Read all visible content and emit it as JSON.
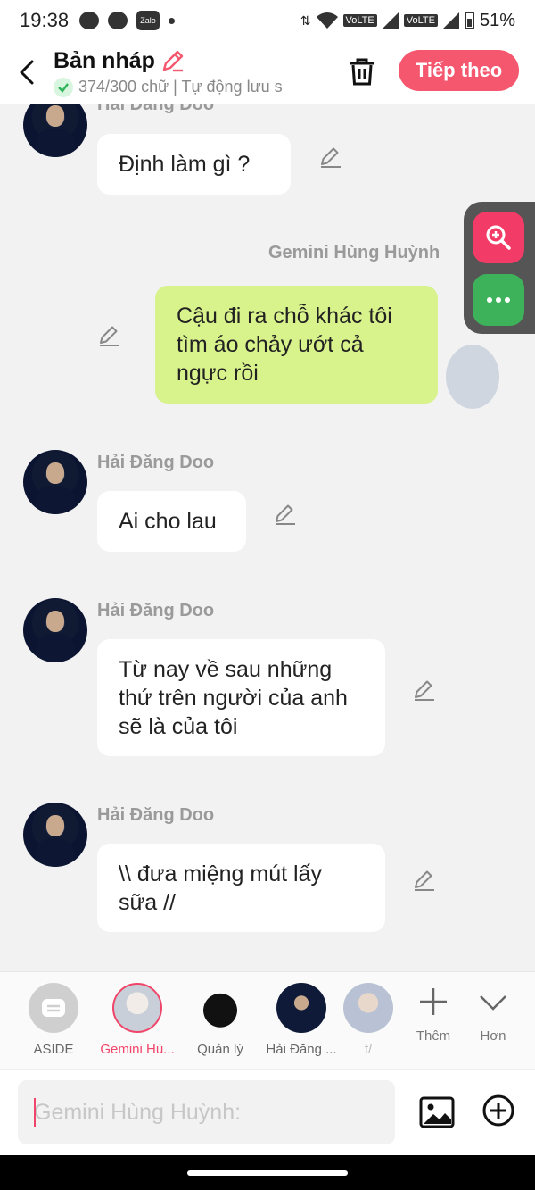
{
  "status_bar": {
    "time": "19:38",
    "zalo": "Zalo",
    "volte1": "VoLTE",
    "volte2": "VoLTE",
    "battery": "51%"
  },
  "header": {
    "title": "Bản nháp",
    "subtitle": "374/300 chữ | Tự động lưu s",
    "next_label": "Tiếp theo"
  },
  "messages": [
    {
      "sender": "Hải Đăng Doo",
      "text": "Định làm gì ?",
      "side": "left"
    },
    {
      "sender": "Gemini Hùng Huỳnh",
      "text": "Cậu đi ra chỗ khác tôi tìm áo chảy ướt cả ngực rồi",
      "side": "right"
    },
    {
      "sender": "Hải Đăng Doo",
      "text": "Ai cho lau",
      "side": "left"
    },
    {
      "sender": "Hải Đăng Doo",
      "text": "Từ nay về sau những thứ trên người của anh sẽ là của tôi",
      "side": "left"
    },
    {
      "sender": "Hải Đăng Doo",
      "text": "\\\\ đưa miệng mút lấy sữa //",
      "side": "left"
    }
  ],
  "characters": [
    {
      "name": "ASIDE"
    },
    {
      "name": "Gemini Hù...",
      "active": true
    },
    {
      "name": "Quản lý"
    },
    {
      "name": "Hải Đăng ..."
    },
    {
      "name": "t/"
    }
  ],
  "tools": {
    "more_label": "Thêm",
    "less_label": "Hơn"
  },
  "input": {
    "placeholder": "Gemini Hùng Huỳnh:"
  },
  "colors": {
    "accent": "#f4576e",
    "my_bubble": "#d8f28c",
    "zoom_fab": "#f23c67",
    "more_fab": "#3eb25b"
  }
}
